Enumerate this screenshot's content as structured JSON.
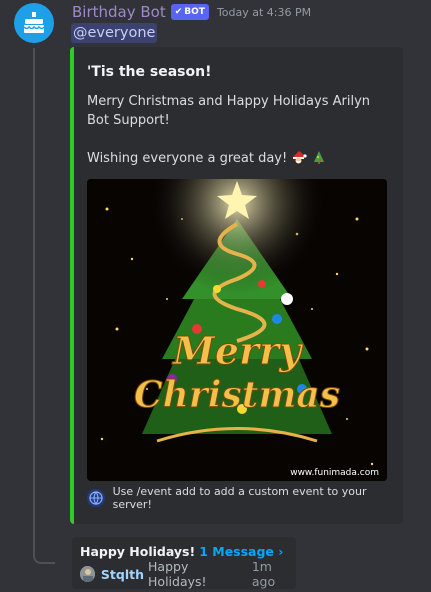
{
  "message": {
    "username": "Birthday Bot",
    "badge": "BOT",
    "timestamp": "Today at 4:36 PM",
    "mention": "@everyone"
  },
  "embed": {
    "title": "'Tis the season!",
    "description_line1": "Merry Christmas and Happy Holidays Arilyn Bot Support!",
    "description_line2": "Wishing everyone a great day!",
    "emojis": [
      "santa-emoji",
      "christmas-tree-emoji"
    ],
    "image_caption_line1": "Merry",
    "image_caption_line2": "Christmas",
    "image_watermark": "www.funimada.com",
    "footer": "Use /event add to add a custom event to your server!",
    "accent_color": "#2ecc27"
  },
  "thread": {
    "name": "Happy Holidays!",
    "count": "1 Message ›",
    "last_user": "Stqlth",
    "last_message": "Happy Holidays!",
    "last_time": "1m ago"
  }
}
